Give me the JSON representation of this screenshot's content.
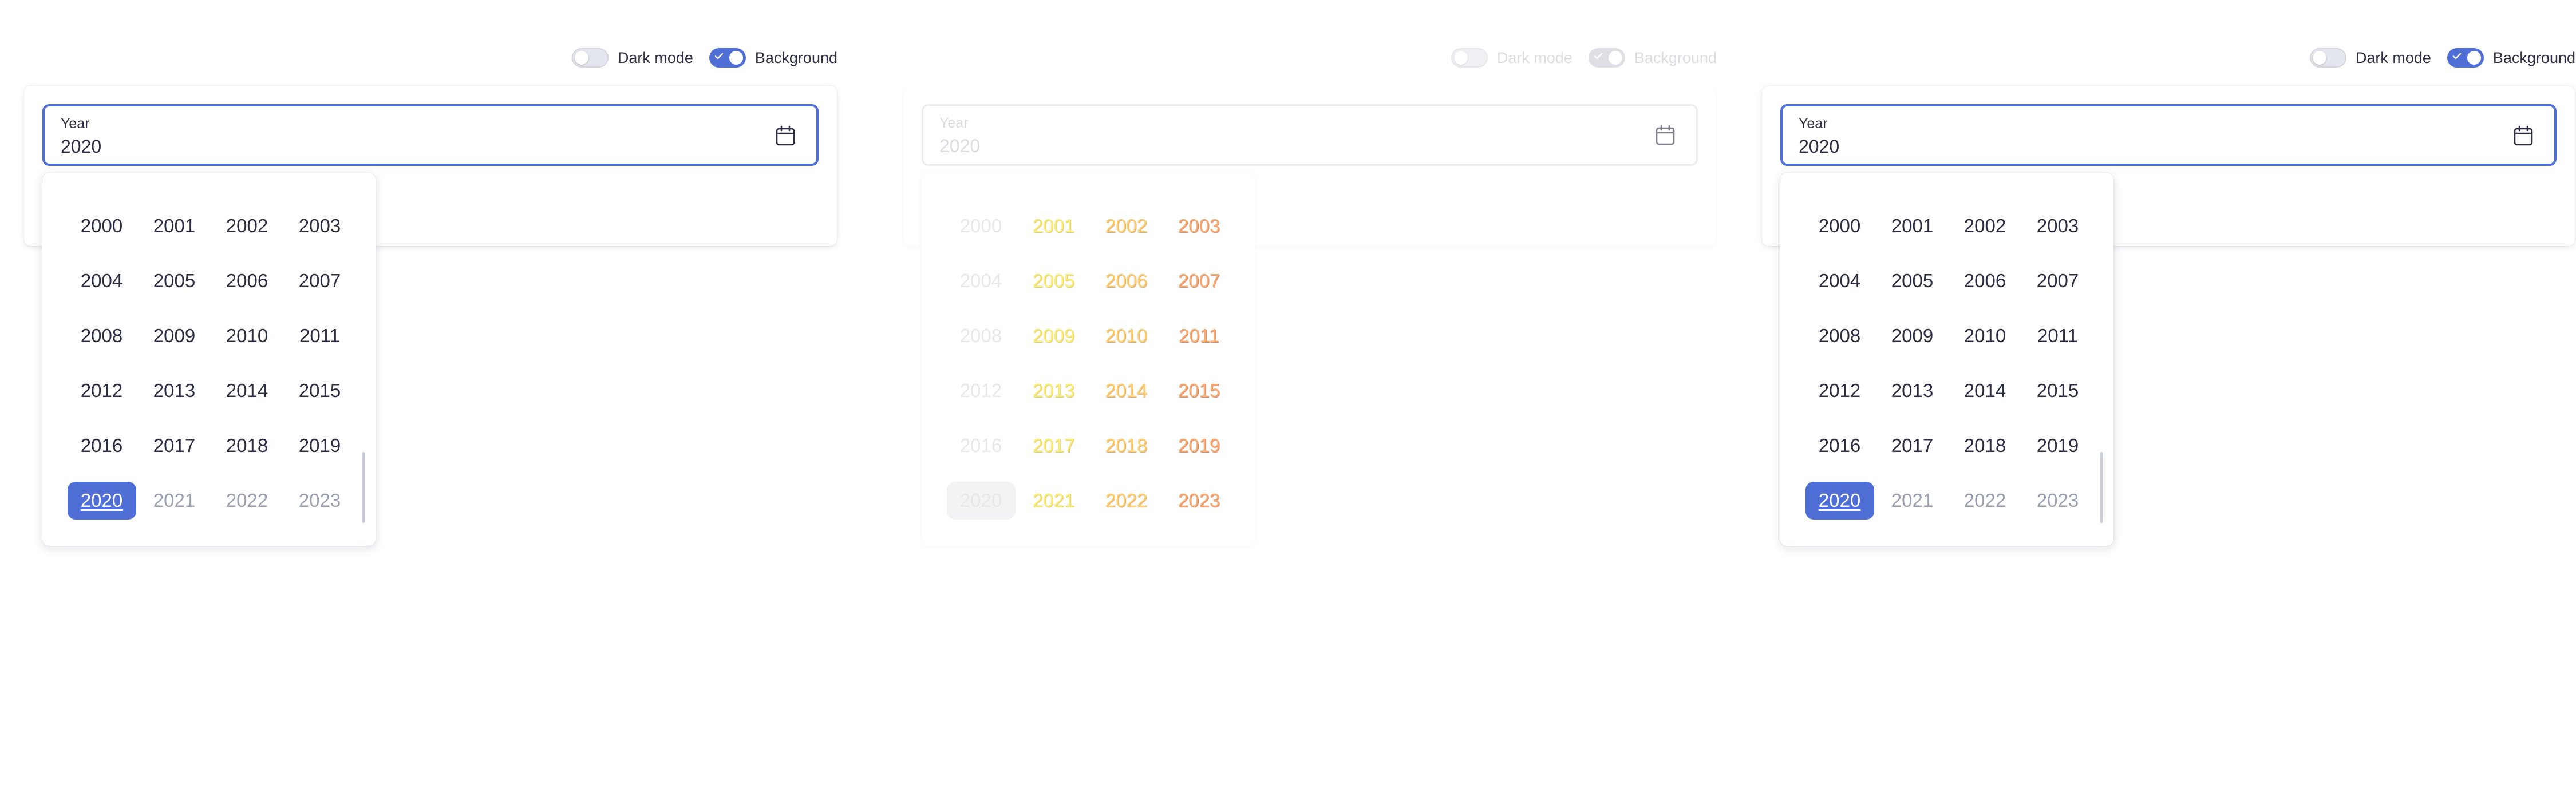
{
  "colors": {
    "accent": "#4f6fd6",
    "text": "#2b2d42",
    "muted": "#9aa0b2"
  },
  "toggles": {
    "dark_mode_label": "Dark mode",
    "background_label": "Background",
    "dark_mode_on": false,
    "background_on": true
  },
  "field": {
    "label": "Year",
    "value": "2020",
    "icon": "calendar-icon"
  },
  "years": [
    "2000",
    "2001",
    "2002",
    "2003",
    "2004",
    "2005",
    "2006",
    "2007",
    "2008",
    "2009",
    "2010",
    "2011",
    "2012",
    "2013",
    "2014",
    "2015",
    "2016",
    "2017",
    "2018",
    "2019",
    "2020",
    "2021",
    "2022",
    "2023"
  ],
  "selected_year": "2020",
  "disabled_years": [
    "2021",
    "2022",
    "2023"
  ]
}
